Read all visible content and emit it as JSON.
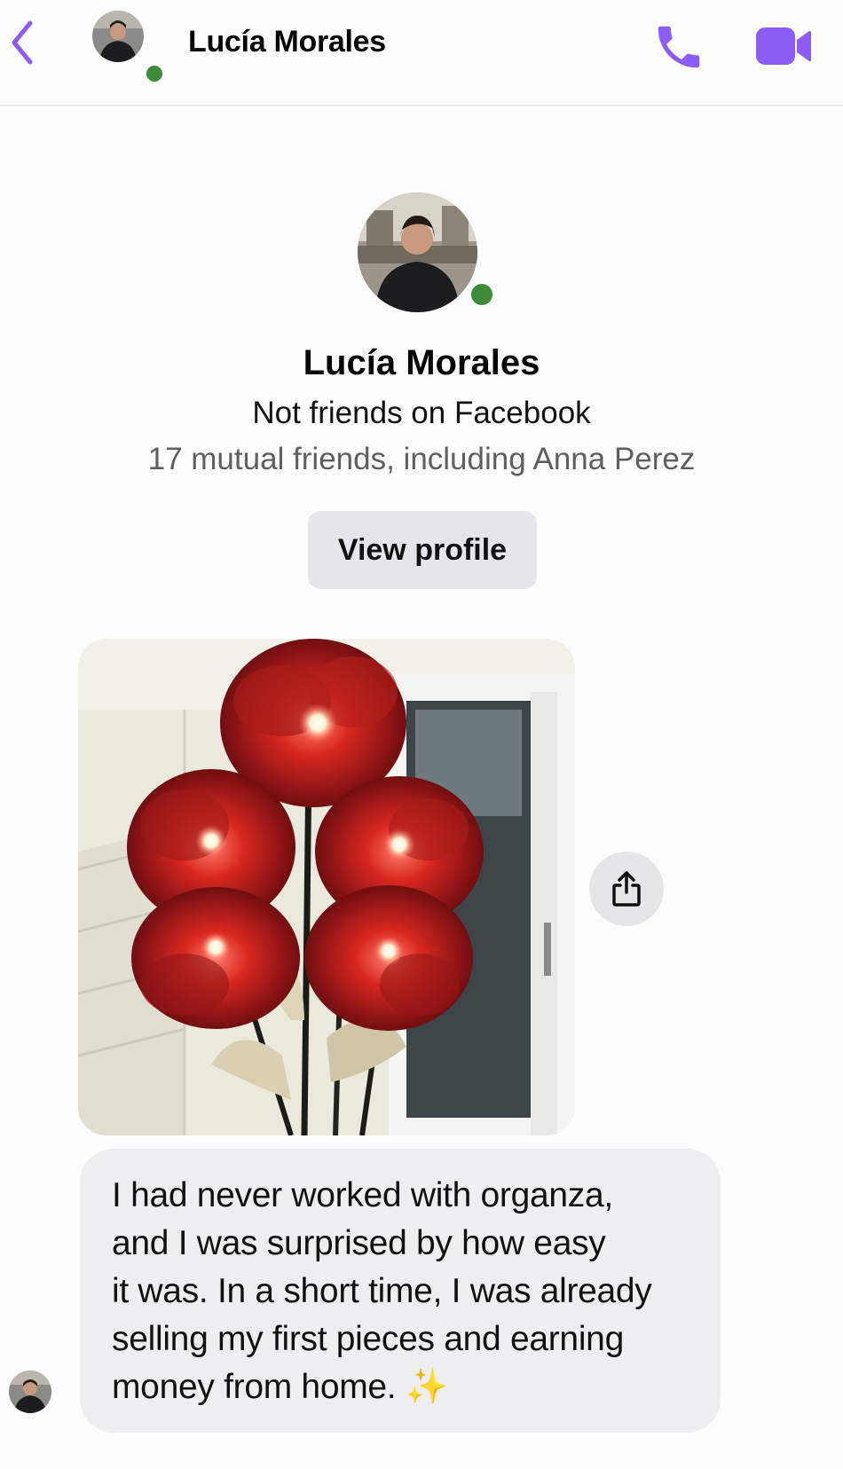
{
  "header": {
    "title": "Lucía Morales",
    "back_icon": "chevron-left-icon",
    "call_icon": "phone-icon",
    "video_icon": "video-camera-icon",
    "accent_color": "#8b5cf6",
    "online_color": "#3f8a3a"
  },
  "profile": {
    "name": "Lucía Morales",
    "relationship": "Not friends on Facebook",
    "mutual_friends": "17 mutual friends, including Anna Perez",
    "view_profile_label": "View profile"
  },
  "messages": [
    {
      "type": "image",
      "share_icon": "share-icon"
    },
    {
      "type": "text",
      "lines": [
        "I had never worked with organza,",
        "and I was surprised by how easy",
        "it was. In a short time, I was already",
        "selling my first pieces and earning",
        "money from home."
      ],
      "emoji": "✨"
    }
  ]
}
